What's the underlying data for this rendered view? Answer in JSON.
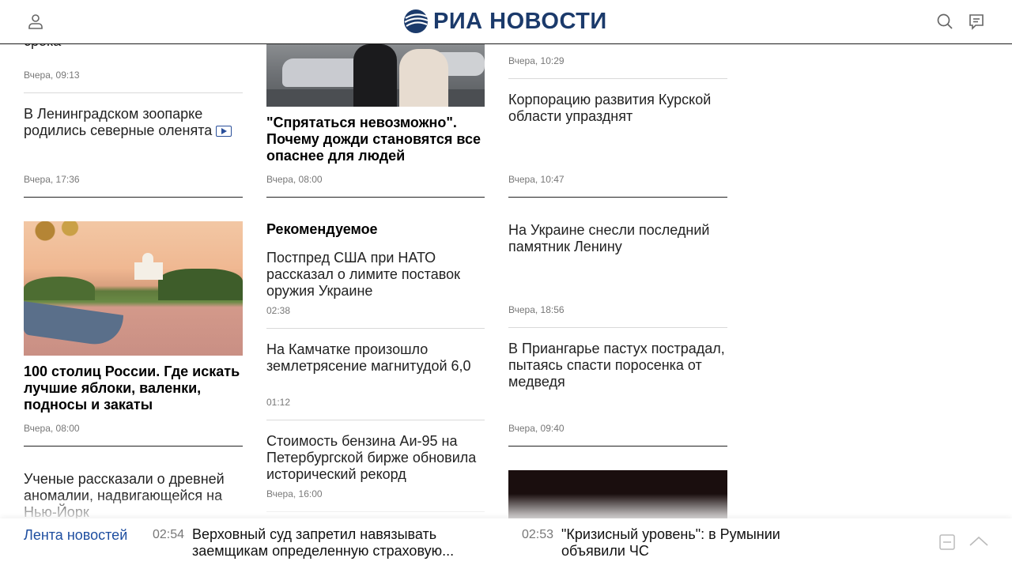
{
  "header": {
    "logo_text": "РИА НОВОСТИ",
    "brand_color": "#1b3a6b"
  },
  "column1": {
    "item0": {
      "title_tail": "срока",
      "time": "Вчера, 09:13"
    },
    "item1": {
      "title": "В Ленинградском зоопарке родились северные оленята",
      "time": "Вчера, 17:36",
      "icon": "video-icon"
    },
    "item2": {
      "title": "100 столиц России. Где искать лучшие яблоки, валенки, подносы и закаты",
      "time": "Вчера, 08:00"
    },
    "item3": {
      "title": "Ученые рассказали о древней аномалии, надвигающейся на Нью-Йорк"
    }
  },
  "column2": {
    "item0": {
      "title": "\"Спрятаться невозможно\". Почему дожди становятся все опаснее для людей",
      "time": "Вчера, 08:00"
    },
    "recommended": {
      "heading": "Рекомендуемое",
      "items": [
        {
          "title": "Постпред США при НАТО рассказал о лимите поставок оружия Украине",
          "time": "02:38"
        },
        {
          "title": "На Камчатке произошло землетрясение магнитудой 6,0",
          "time": "01:12"
        },
        {
          "title": "Стоимость бензина Аи-95 на Петербургской бирже обновила исторический рекорд",
          "time": "Вчера, 16:00"
        }
      ]
    }
  },
  "column3": {
    "item0": {
      "time": "Вчера, 10:29"
    },
    "item1": {
      "title": "Корпорацию развития Курской области упразднят",
      "time": "Вчера, 10:47"
    },
    "item2": {
      "title": "На Украине снесли последний памятник Ленину",
      "time": "Вчера, 18:56"
    },
    "item3": {
      "title": "В Приангарье пастух пострадал, пытаясь спасти поросенка от медведя",
      "time": "Вчера, 09:40"
    }
  },
  "ticker": {
    "label": "Лента новостей",
    "items": [
      {
        "time": "02:54",
        "text": "Верховный суд запретил навязывать заемщикам определенную страховую..."
      },
      {
        "time": "02:53",
        "text": "\"Кризисный уровень\": в Румынии объявили ЧС"
      }
    ],
    "accent_color": "#1e4ea0"
  }
}
